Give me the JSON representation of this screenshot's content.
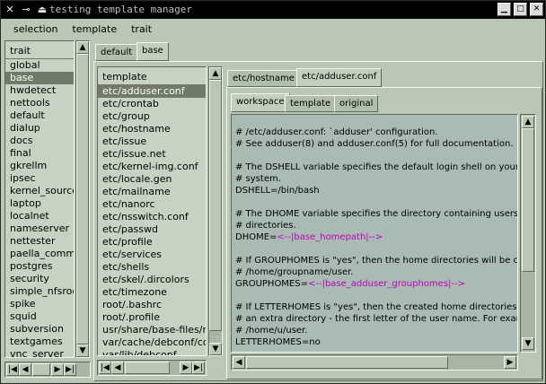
{
  "window": {
    "title": "testing template manager",
    "icons": [
      "close-x-icon",
      "pin-icon",
      "shade-icon"
    ],
    "controls": [
      "minimize-icon",
      "maximize-icon",
      "close-icon"
    ]
  },
  "menu": [
    "selection",
    "template",
    "trait"
  ],
  "trait_panel": {
    "header": "trait",
    "items": [
      "global",
      "base",
      "hwdetect",
      "nettools",
      "default",
      "dialup",
      "docs",
      "final",
      "gkrellm",
      "ipsec",
      "kernel_sources",
      "laptop",
      "localnet",
      "nameserver",
      "nettester",
      "paella_comme",
      "postgres",
      "security",
      "simple_nfsroot",
      "spike",
      "squid",
      "subversion",
      "textgames",
      "vnc_server"
    ],
    "selected": "base"
  },
  "suite_tabs": [
    "default",
    "base"
  ],
  "template_panel": {
    "header": "template",
    "items": [
      "etc/adduser.conf",
      "etc/crontab",
      "etc/group",
      "etc/hostname",
      "etc/issue",
      "etc/issue.net",
      "etc/kernel-img.conf",
      "etc/locale.gen",
      "etc/mailname",
      "etc/nanorc",
      "etc/nsswitch.conf",
      "etc/passwd",
      "etc/profile",
      "etc/services",
      "etc/shells",
      "etc/skel/.dircolors",
      "etc/timezone",
      "root/.bashrc",
      "root/.profile",
      "usr/share/base-files/motd",
      "var/cache/debconf/config",
      "var/lib/debconf"
    ],
    "selected": "etc/adduser.conf"
  },
  "file_tabs": [
    "etc/hostname",
    "etc/adduser.conf"
  ],
  "view_tabs": [
    "workspace",
    "template",
    "original"
  ],
  "editor": {
    "lines": [
      {
        "t": ""
      },
      {
        "t": "# /etc/adduser.conf: `adduser' configuration."
      },
      {
        "t": "# See adduser(8) and adduser.conf(5) for full documentation."
      },
      {
        "t": ""
      },
      {
        "t": "# The DSHELL variable specifies the default login shell on your"
      },
      {
        "t": "# system."
      },
      {
        "t": "DSHELL=/bin/bash"
      },
      {
        "t": ""
      },
      {
        "t": "# The DHOME variable specifies the directory containing users' ho"
      },
      {
        "t": "# directories."
      },
      {
        "t": "DHOME=",
        "m": "<--|base_homepath|-->"
      },
      {
        "t": ""
      },
      {
        "t": "# If GROUPHOMES is \"yes\", then the home directories will be crea"
      },
      {
        "t": "# /home/groupname/user."
      },
      {
        "t": "GROUPHOMES=",
        "m": "<--|base_adduser_grouphomes|-->"
      },
      {
        "t": ""
      },
      {
        "t": "# If LETTERHOMES is \"yes\", then the created home directories wil"
      },
      {
        "t": "# an extra directory - the first letter of the user name. For example:"
      },
      {
        "t": "# /home/u/user."
      },
      {
        "t": "LETTERHOMES=no"
      }
    ]
  },
  "scroll": {
    "up": "▲",
    "down": "▼",
    "left": "◀",
    "right": "▶",
    "first": "|◀",
    "last": "▶|"
  }
}
